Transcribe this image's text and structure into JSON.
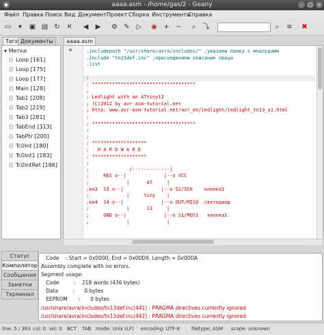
{
  "window": {
    "title": "aaaa.asm - /home/gas/2 - Geany",
    "app_icon": "geany-icon"
  },
  "menu": [
    "Файл",
    "Правка",
    "Поиск",
    "Вид",
    "Документ",
    "Проект",
    "Сборка",
    "Инструменты",
    "Справка"
  ],
  "sidebar": {
    "tabs": [
      "Теги",
      "Документы"
    ],
    "root_label": "Метки",
    "items": [
      "Loop [161]",
      "Loop [175]",
      "Loop [177]",
      "Main [128]",
      "Tab1 [208]",
      "Tab2 [219]",
      "Tab3 [281]",
      "TabEnd [313]",
      "TabPtr [200]",
      "Tc0Int [180]",
      "Tc0Int1 [183]",
      "Tc0IntRet [186]"
    ]
  },
  "editor": {
    "tab_label": "aaaa.asm",
    "lines": [
      ".includepath \"/usr/share/avra/includes/\" ;указали папку с инклудами",
      ".include \"tn13def.inc\" ;присоединили описание проца",
      ".list",
      "",
      ";",
      "; ************************************",
      ";",
      "; Ledlight with an ATtiny13",
      "; (C)2012 by avr-asm-tutorial.net",
      "; http: www.avr-asm-tutorial.net/avr_en/ledlight/ledlight_tn13_v1.html",
      ";",
      "; ************************************",
      ";",
      ";",
      "; *******************",
      ";   H A R D W A R E",
      "; *******************",
      ";",
      ";              /-------------|",
      ";     RES o--|             |--o VCC",
      ";             |      AT     |",
      ";кн3  S3 o--|             |--o S2/SCK    кнопка2",
      ";             |     tiny    |",
      ";кн4  S4 o--|             |--o OUT/MISO  светодиод",
      ";             |      13     |",
      ";     GND o--|             |--o S1/MOSI   кнопка1",
      ";             |             |"
    ]
  },
  "messages": {
    "tabs": [
      "Статус",
      "Компилятор",
      "Сообщения",
      "Заметки",
      "Терминал"
    ],
    "active_tab": "Компилятор",
    "lines": [
      "   Code    : Start = 0x0000, End = 0x00D9, Length = 0x00DA",
      "Assembly complete with no errors.",
      "Segment usage:",
      "   Code         :    218 words (436 bytes)",
      "   Data         :      0 bytes",
      "   EEPROM       :      0 bytes",
      "/usr/share/avra/includes/tn13def.inc(441) : PRAGMA directives currently ignored",
      "/usr/share/avra/includes/tn13def.inc(442) : PRAGMA directives currently ignored"
    ]
  },
  "status": {
    "line": "line: 5 / 363",
    "col": "col: 0",
    "sel": "sel: 0",
    "ins": "ВСТ",
    "tab": "TAB",
    "mode": "mode: Unix (LF)",
    "encoding": "encoding: UTF-8",
    "filetype": "filetype: ASM",
    "scope": "scope: unknown"
  }
}
